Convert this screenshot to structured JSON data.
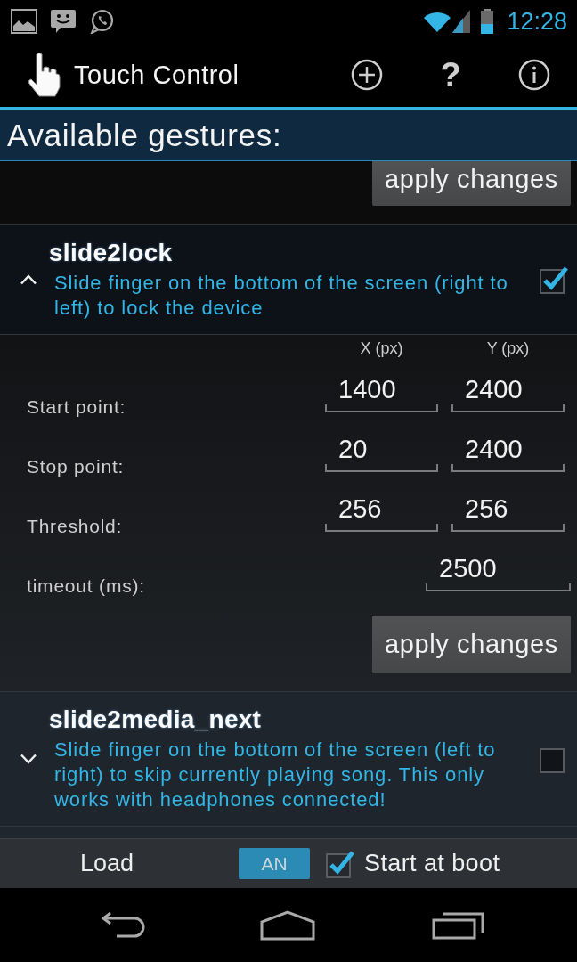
{
  "status_bar": {
    "time": "12:28"
  },
  "action_bar": {
    "title": "Touch Control",
    "actions": [
      {
        "kind": "add"
      },
      {
        "kind": "help",
        "glyph": "?"
      },
      {
        "kind": "info"
      }
    ]
  },
  "section_header": "Available gestures:",
  "above_item": {
    "button": "apply changes"
  },
  "gestures": [
    {
      "name": "slide2lock",
      "description": "Slide finger on the bottom of the screen (right to left) to lock the device",
      "expanded": true,
      "checked": true,
      "settings": {
        "columns": [
          "X (px)",
          "Y (px)"
        ],
        "rows": [
          {
            "label": "Start point:",
            "values": [
              "1400",
              "2400"
            ]
          },
          {
            "label": "Stop point:",
            "values": [
              "20",
              "2400"
            ]
          },
          {
            "label": "Threshold:",
            "values": [
              "256",
              "256"
            ]
          },
          {
            "label": "timeout (ms):",
            "values": [
              "2500"
            ]
          }
        ],
        "button": "apply changes"
      }
    },
    {
      "name": "slide2media_next",
      "description": "Slide finger on the bottom of the screen (left to right) to skip currently playing song. This only works with headphones connected!",
      "expanded": false,
      "checked": false
    }
  ],
  "bottom_bar": {
    "load_button": "Load",
    "toggle": {
      "label": "AN",
      "on": true
    },
    "start_at_boot": {
      "label": "Start at boot",
      "checked": true
    }
  }
}
